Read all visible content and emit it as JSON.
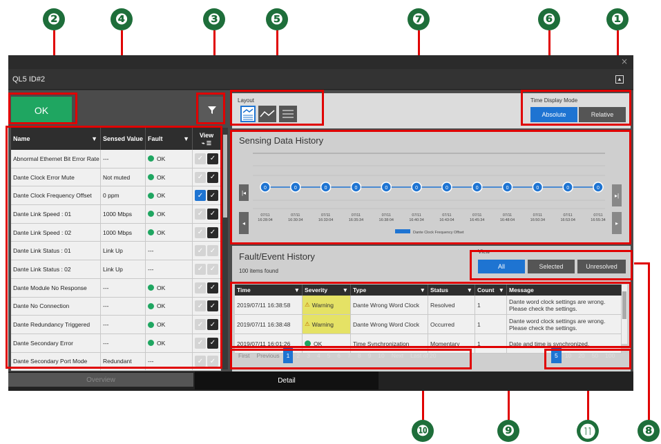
{
  "window": {
    "close_label": "×",
    "device_title": "QL5 ID#2"
  },
  "status": {
    "ok_label": "OK"
  },
  "callouts": [
    "❷",
    "❹",
    "❸",
    "❺",
    "❼",
    "❻",
    "❶",
    "❿",
    "❾",
    "⓫",
    "❽"
  ],
  "table": {
    "headers": {
      "name": "Name",
      "sensed": "Sensed Value",
      "fault": "Fault",
      "view": "View"
    },
    "rows": [
      {
        "name": "Abnormal Ethernet Bit Error Rate",
        "sensed": "---",
        "fault": "OK",
        "c1": false,
        "c2": true,
        "blue": false
      },
      {
        "name": "Dante Clock Error Mute",
        "sensed": "Not muted",
        "fault": "OK",
        "c1": false,
        "c2": true,
        "blue": false
      },
      {
        "name": "Dante Clock Frequency Offset",
        "sensed": "0 ppm",
        "fault": "OK",
        "c1": true,
        "c2": true,
        "blue": true
      },
      {
        "name": "Dante Link Speed : 01",
        "sensed": "1000 Mbps",
        "fault": "OK",
        "c1": false,
        "c2": true,
        "blue": false
      },
      {
        "name": "Dante Link Speed : 02",
        "sensed": "1000 Mbps",
        "fault": "OK",
        "c1": false,
        "c2": true,
        "blue": false
      },
      {
        "name": "Dante Link Status : 01",
        "sensed": "Link Up",
        "fault": "---",
        "c1": false,
        "c2": false,
        "blue": false
      },
      {
        "name": "Dante Link Status : 02",
        "sensed": "Link Up",
        "fault": "---",
        "c1": false,
        "c2": false,
        "blue": false
      },
      {
        "name": "Dante Module No Response",
        "sensed": "---",
        "fault": "OK",
        "c1": false,
        "c2": true,
        "blue": false
      },
      {
        "name": "Dante No Connection",
        "sensed": "---",
        "fault": "OK",
        "c1": false,
        "c2": true,
        "blue": false
      },
      {
        "name": "Dante Redundancy Triggered",
        "sensed": "---",
        "fault": "OK",
        "c1": false,
        "c2": true,
        "blue": false
      },
      {
        "name": "Dante Secondary Error",
        "sensed": "---",
        "fault": "OK",
        "c1": false,
        "c2": true,
        "blue": false
      },
      {
        "name": "Dante Secondary Port Mode",
        "sensed": "Redundant",
        "fault": "---",
        "c1": false,
        "c2": false,
        "blue": false
      }
    ]
  },
  "layout": {
    "label": "Layout"
  },
  "time_mode": {
    "label": "Time Display Mode",
    "absolute": "Absolute",
    "relative": "Relative"
  },
  "sensing": {
    "title": "Sensing Data History",
    "times": [
      "07/11 16:28:04",
      "07/11 16:30:34",
      "07/11 16:33:04",
      "07/11 16:35:34",
      "07/11 16:38:04",
      "07/11 16:40:34",
      "07/11 16:43:04",
      "07/11 16:45:34",
      "07/11 16:48:04",
      "07/11 16:50:34",
      "07/11 16:53:04",
      "07/11 16:55:34"
    ],
    "values": [
      0,
      0,
      0,
      0,
      0,
      0,
      0,
      0,
      0,
      0,
      0,
      0
    ],
    "legend": "Dante Clock Frequency Offset",
    "series_color": "#1e74d2"
  },
  "fault_history": {
    "title": "Fault/Event History",
    "found": "100 items found",
    "view_label": "View",
    "view_all": "All",
    "view_selected": "Selected",
    "view_unresolved": "Unresolved",
    "headers": {
      "time": "Time",
      "severity": "Severity",
      "type": "Type",
      "status": "Status",
      "count": "Count",
      "message": "Message"
    },
    "rows": [
      {
        "time": "2019/07/11 16:38:58",
        "severity": "Warning",
        "type": "Dante Wrong Word Clock",
        "status": "Resolved",
        "count": "1",
        "message": "Dante word clock settings are wrong. Please check the settings."
      },
      {
        "time": "2019/07/11 16:38:48",
        "severity": "Warning",
        "type": "Dante Wrong Word Clock",
        "status": "Occurred",
        "count": "1",
        "message": "Dante word clock settings are wrong. Please check the settings."
      },
      {
        "time": "2019/07/11 16:01:26",
        "severity": "OK",
        "type": "Time Synchronization",
        "status": "Momentary",
        "count": "1",
        "message": "Date and time is synchronized."
      }
    ]
  },
  "pager": {
    "first": "First",
    "previous": "Previous",
    "pages": [
      "1",
      "2",
      "3",
      "4",
      "5",
      "6",
      "7",
      "8",
      "9",
      "10"
    ],
    "next": "Next",
    "last": "Last of 20"
  },
  "page_size": [
    "5",
    "10",
    "20",
    "50",
    "100"
  ],
  "tabs": {
    "overview": "Overview",
    "detail": "Detail"
  }
}
